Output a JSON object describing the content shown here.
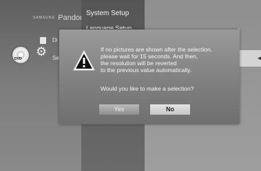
{
  "menu": {
    "brand_small": "SAMSUNG",
    "brand": "Pandora",
    "item_di_fragment": "Di",
    "item_se_fragment": "Se",
    "dvd_icon_label": "DVD"
  },
  "setup": {
    "title": "System Setup",
    "submenu_item": "Language Setup",
    "right_fragment": "l"
  },
  "dialog": {
    "message_lines": [
      "If no pictures are shown after the selection,",
      "please wait for 15 seconds. And then,",
      "the resolution will be reverted",
      "to the previous value automatically."
    ],
    "question": "Would you like to make a selection?",
    "yes_label": "Yes",
    "no_label": "No",
    "focused_button": "No"
  },
  "icons": {
    "warning": "warning-triangle-icon",
    "gear": "gear-icon",
    "disc": "dvd-disc-icon",
    "document": "document-icon",
    "arrow": "arrow-left-icon"
  },
  "colors": {
    "dialog_bg": "#808080",
    "focused_button_bg": "#d6d6d6",
    "text_light": "#f8f8f8"
  }
}
